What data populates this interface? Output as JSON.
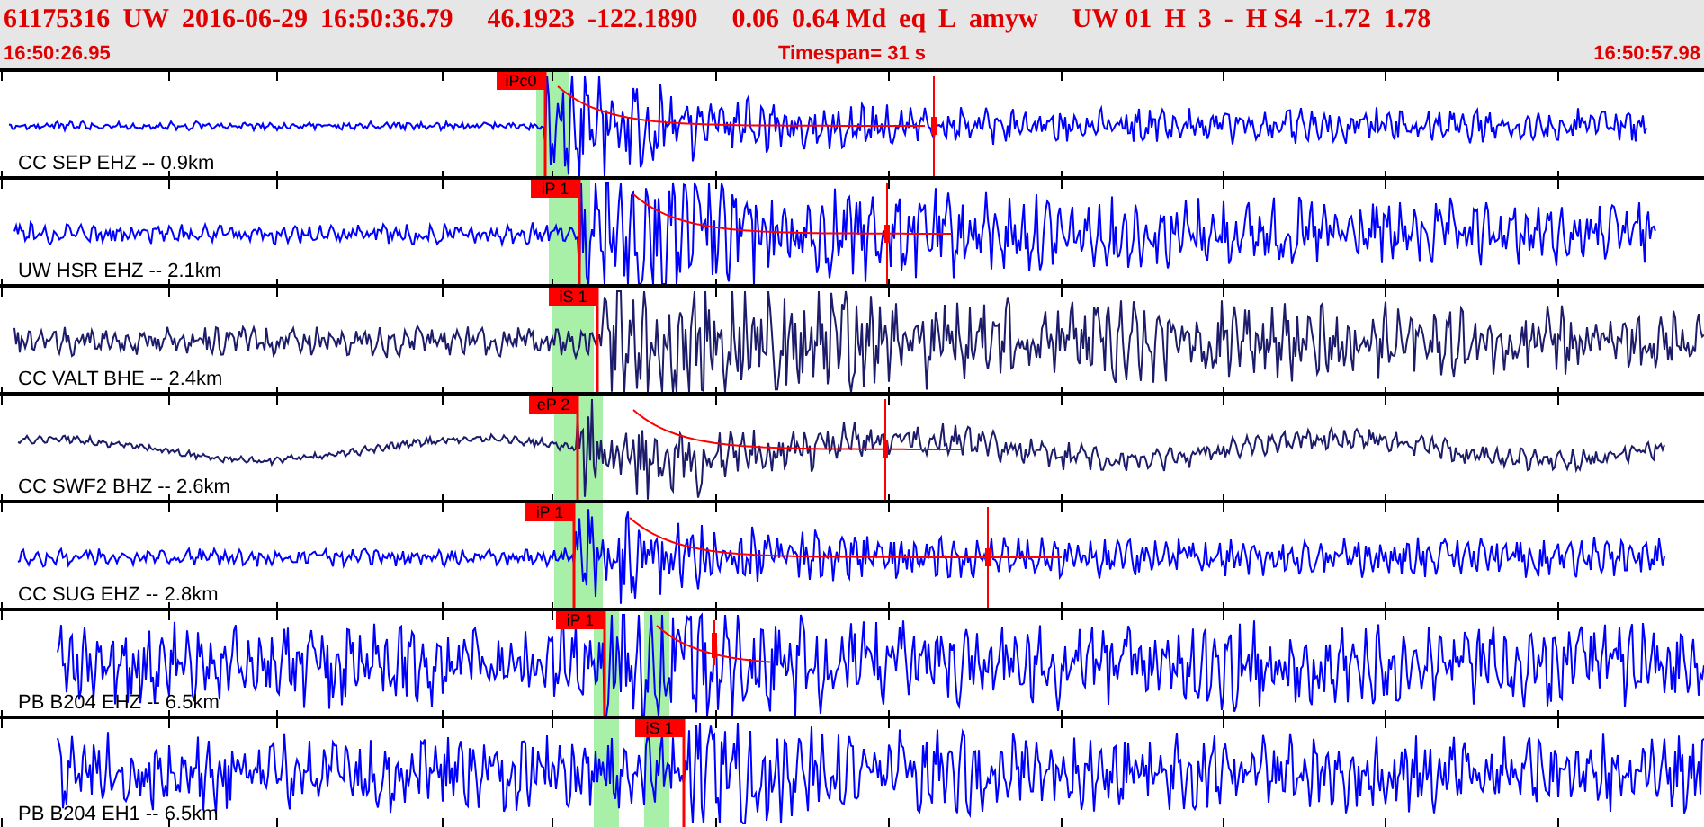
{
  "header": {
    "fields": [
      "61175316",
      "UW",
      "2016-06-29",
      "16:50:36.79",
      "46.1923",
      "-122.1890",
      "0.06",
      "0.64 Md",
      "eq",
      "L",
      "amyw",
      "UW 01",
      "H",
      "3",
      "-",
      "H S4",
      "-1.72",
      "1.78"
    ]
  },
  "time_bar": {
    "start": "16:50:26.95",
    "timespan": "Timespan=  31 s",
    "end": "16:50:57.98"
  },
  "traces": [
    {
      "label": "CC SEP EHZ -- 0.9km",
      "pick": "iPc0",
      "color": "#0000ff"
    },
    {
      "label": "UW HSR EHZ -- 2.1km",
      "pick": "iP 1",
      "color": "#0000ff"
    },
    {
      "label": "CC VALT BHE -- 2.4km",
      "pick": "iS 1",
      "color": "#1c1c6b"
    },
    {
      "label": "CC SWF2 BHZ -- 2.6km",
      "pick": "eP 2",
      "color": "#1c1c6b"
    },
    {
      "label": "CC SUG EHZ -- 2.8km",
      "pick": "iP 1",
      "color": "#0000ff"
    },
    {
      "label": "PB B204 EHZ -- 6.5km",
      "pick": "iP 1",
      "color": "#0000ff"
    },
    {
      "label": "PB B204 EH1 -- 6.5km",
      "pick": "iS 1",
      "color": "#0000ff"
    }
  ]
}
